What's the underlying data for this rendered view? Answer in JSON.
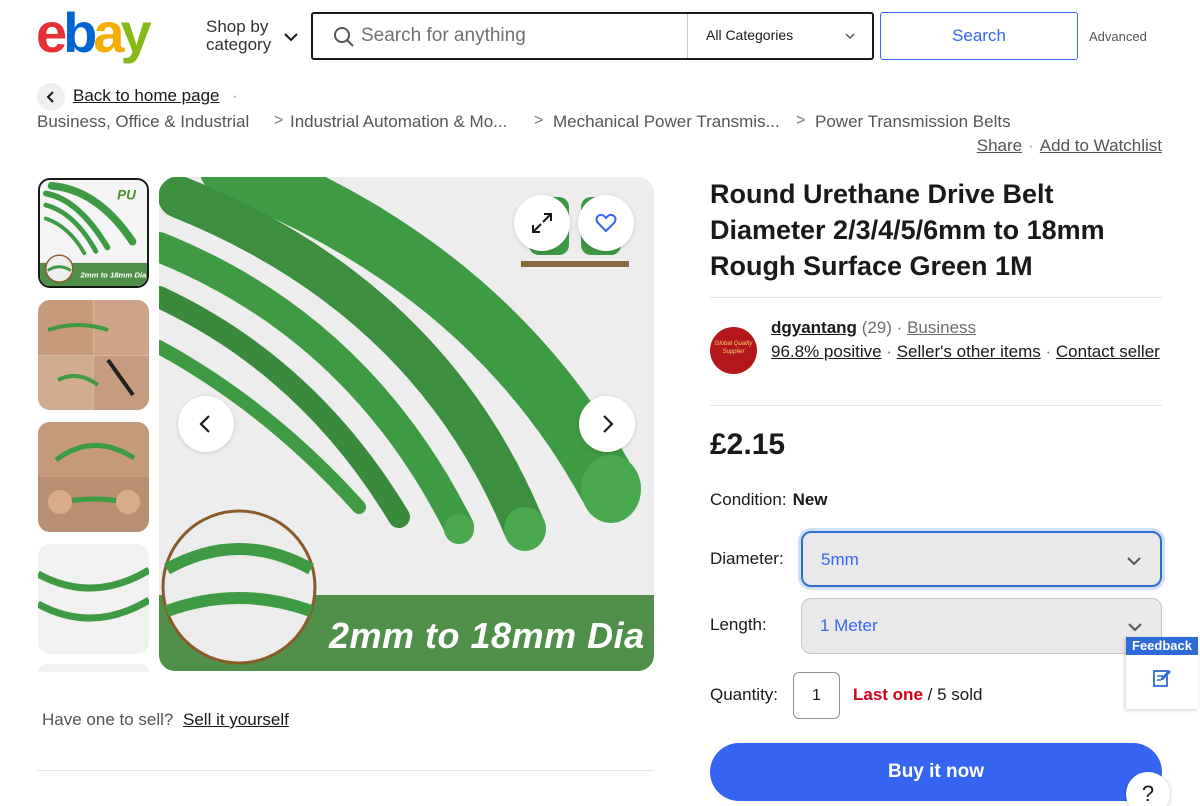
{
  "header": {
    "logo_text": "ebay",
    "shop_by_line1": "Shop by",
    "shop_by_line2": "category",
    "search_placeholder": "Search for anything",
    "category_selected": "All Categories",
    "search_button": "Search",
    "advanced_link": "Advanced"
  },
  "breadcrumb": {
    "back_label": "Back to home page",
    "back_dot": "·",
    "items": [
      "Business, Office & Industrial",
      "Industrial Automation & Mo...",
      "Mechanical Power Transmis...",
      "Power Transmission Belts"
    ],
    "separator": ">"
  },
  "actions": {
    "share": "Share",
    "watchlist": "Add to Watchlist",
    "dot": "·"
  },
  "gallery": {
    "thumb1_badge": "PU",
    "thumb1_caption": "2mm to 18mm Dia",
    "main_banner": "2mm to 18mm Dia",
    "icons": [
      "expand-icon",
      "heart-icon",
      "chevron-left-icon",
      "chevron-right-icon"
    ]
  },
  "product": {
    "title": "Round Urethane Drive Belt Diameter 2/3/4/5/6mm to 18mm Rough Surface Green 1M",
    "price": "£2.15",
    "condition_label": "Condition:",
    "condition_value": "New",
    "diameter_label": "Diameter:",
    "diameter_value": "5mm",
    "length_label": "Length:",
    "length_value": "1 Meter",
    "quantity_label": "Quantity:",
    "quantity_value": "1",
    "stock_red": "Last one",
    "stock_rest": " / 5 sold",
    "buy_button": "Buy it now"
  },
  "seller": {
    "avatar_text": "Global Quality Supplier",
    "name": "dgyantang",
    "feedback_count": "(29)",
    "dot": "·",
    "type": "Business",
    "positive": "96.8% positive",
    "other_items": "Seller's other items",
    "contact": "Contact seller"
  },
  "sell": {
    "prompt": "Have one to sell?",
    "link": "Sell it yourself"
  },
  "widgets": {
    "feedback_title": "Feedback",
    "help": "?"
  },
  "colors": {
    "accent": "#3665f3",
    "belt_green": "#3f9a44",
    "banner_green": "#4f8f4a",
    "stock_red": "#d0021b",
    "ebay_red": "#e53238",
    "ebay_blue": "#0064d2",
    "ebay_yellow": "#f5af02",
    "ebay_green": "#86b817"
  }
}
